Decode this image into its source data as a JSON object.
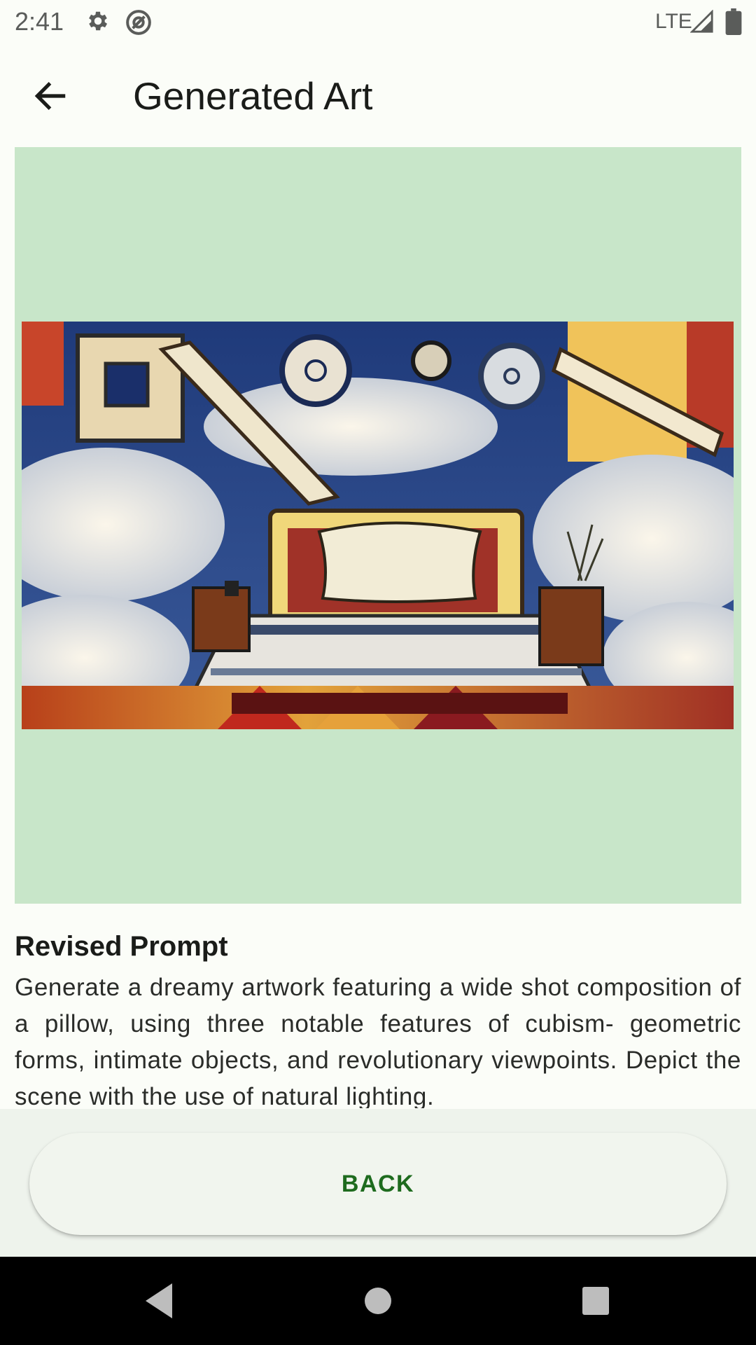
{
  "status_bar": {
    "time": "2:41",
    "network": "LTE",
    "icons": [
      "settings-icon",
      "at-sign-icon",
      "signal-icon",
      "battery-icon"
    ]
  },
  "app_bar": {
    "title": "Generated Art",
    "back_icon": "arrow-left-icon"
  },
  "artwork": {
    "frame_color": "#c8e6c9"
  },
  "prompt": {
    "heading": "Revised Prompt",
    "text": "Generate a dreamy artwork featuring a wide shot composition of a pillow, using three notable features of cubism- geometric forms, intimate objects, and revolutionary viewpoints. Depict the scene with the use of natural lighting."
  },
  "actions": {
    "back_label": "BACK"
  },
  "nav_bar": {
    "buttons": [
      "nav-back-icon",
      "nav-home-icon",
      "nav-recents-icon"
    ]
  },
  "colors": {
    "accent": "#1e6b1e",
    "background": "#fbfdf8",
    "bottom_area": "#eef3ec"
  }
}
